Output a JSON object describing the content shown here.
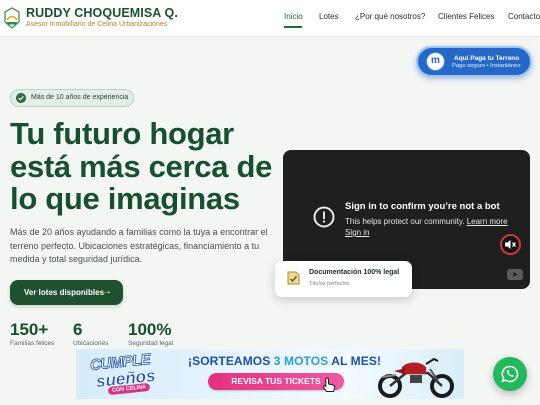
{
  "header": {
    "logo_alt": "CELINA",
    "brand_name": "RUDDY CHOQUEMISA Q.",
    "brand_subtitle": "Asesor Inmobiliario de Celina Urbanizaciones",
    "nav": [
      {
        "label": "Inicio",
        "active": true
      },
      {
        "label": "Lotes",
        "active": false
      },
      {
        "label": "¿Por qué nosotros?",
        "active": false
      },
      {
        "label": "Clientes Felices",
        "active": false
      },
      {
        "label": "Contacto",
        "active": false
      }
    ]
  },
  "pay_button": {
    "icon_letter": "m",
    "title": "Aquí Paga tu Terreno",
    "subtitle": "Pago seguro • Instantáneo"
  },
  "hero": {
    "badge": "Más de 10 años de experiencia",
    "title_lines": [
      "Tu futuro hogar",
      "está más cerca de",
      "lo que imaginas"
    ],
    "description": "Más de 20 años ayudando a familias como la tuya a encontrar el terreno perfecto. Ubicaciones estratégicas, financiamiento a tu medida y total seguridad jurídica.",
    "cta_label": "Ver lotes disponibles",
    "cta_arrow": "→",
    "stats": [
      {
        "value": "150+",
        "label": "Familias felices"
      },
      {
        "value": "6",
        "label": "Ubicaciones"
      },
      {
        "value": "100%",
        "label": "Seguridad legal"
      }
    ]
  },
  "video": {
    "title": "Sign in to confirm you’re not a bot",
    "text": "This helps protect our community.",
    "link": "Learn more",
    "link2": "Sign in",
    "icons": [
      "alert-icon",
      "mute-icon",
      "youtube-icon"
    ]
  },
  "doc_card": {
    "title": "Documentación 100% legal",
    "subtitle": "Títulos perfectos"
  },
  "banner": {
    "cumple": "CUMPLE",
    "suenos": "sueños",
    "con_celina": "CON CELINA",
    "sorteo_prefix": "¡SORTEAMOS ",
    "sorteo_highlight": "3 MOTOS",
    "sorteo_suffix": " AL MES!",
    "button": "REVISA TUS TICKETS"
  },
  "colors": {
    "primary": "#17502d",
    "accent_gold": "#b2852d",
    "pay_blue": "#2568c7",
    "whatsapp": "#22b95b"
  }
}
